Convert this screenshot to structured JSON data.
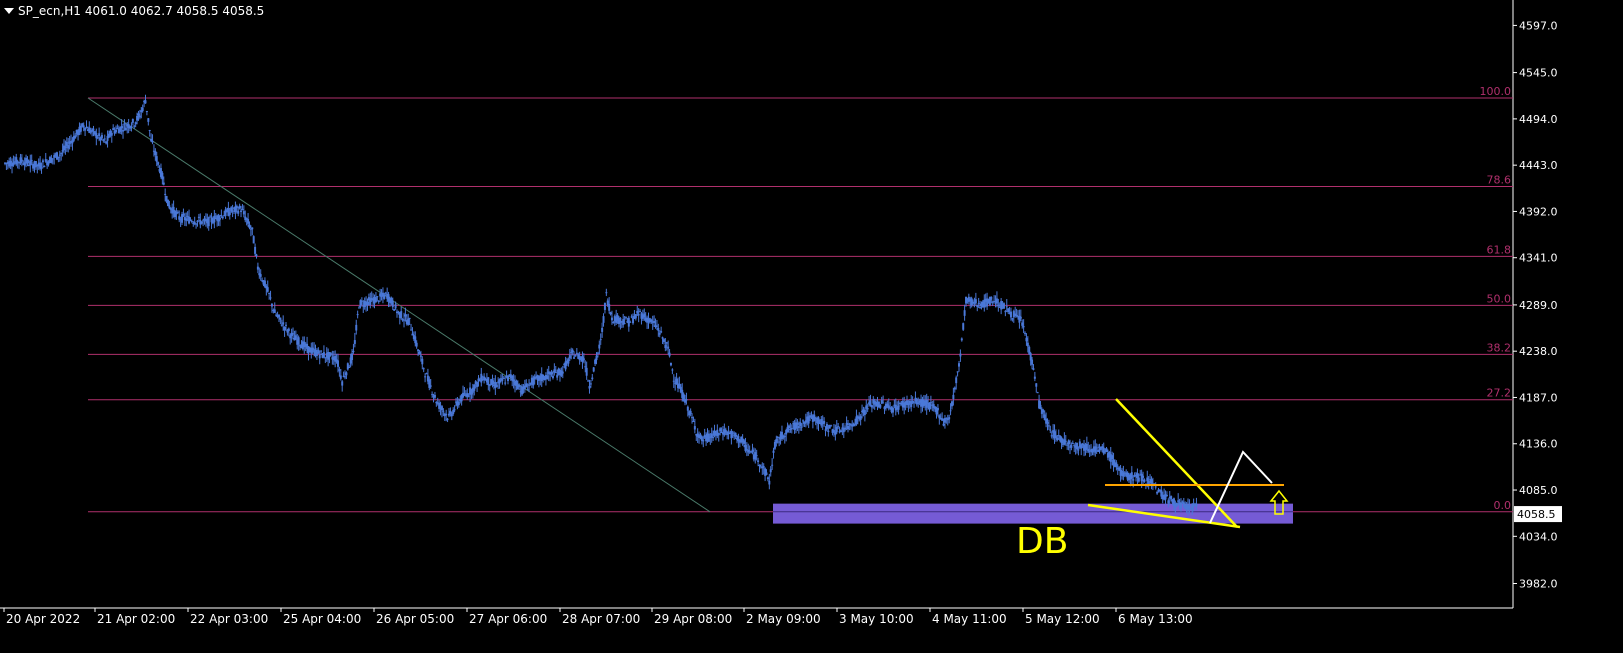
{
  "header": {
    "symbol": "SP_ecn,H1",
    "ohlc": "4061.0 4062.7 4058.5 4058.5"
  },
  "y_ticks": [
    "4597.0",
    "4545.0",
    "4494.0",
    "4443.0",
    "4392.0",
    "4341.0",
    "4289.0",
    "4238.0",
    "4187.0",
    "4136.0",
    "4085.0",
    "4034.0",
    "3982.0"
  ],
  "x_ticks": [
    "20 Apr 2022",
    "21 Apr 02:00",
    "22 Apr 03:00",
    "25 Apr 04:00",
    "26 Apr 05:00",
    "27 Apr 06:00",
    "28 Apr 07:00",
    "29 Apr 08:00",
    "2 May 09:00",
    "3 May 10:00",
    "4 May 11:00",
    "5 May 12:00",
    "6 May 13:00"
  ],
  "price_label": "4058.5",
  "fib_levels": [
    "100.0",
    "78.6",
    "61.8",
    "50.0",
    "38.2",
    "27.2",
    "0.0"
  ],
  "annotation": "DB",
  "colors": {
    "background": "#000000",
    "axis": "#ffffff",
    "candle": "#4a78d8",
    "fib": "#b0306c",
    "zone": "#7b60e0",
    "trendline": "#ffff00",
    "resistance": "#ffa500",
    "projection": "#ffffff",
    "arrow": "#ffff00",
    "diagonal": "#4a7a6a"
  },
  "chart_data": {
    "type": "candlestick",
    "ylim": [
      3955,
      4625
    ],
    "price_line": 4058.5,
    "fib_prices": [
      4517,
      4419.5,
      4342.5,
      4288.5,
      4234.5,
      4184.5,
      4061
    ],
    "path": [
      [
        0,
        4445
      ],
      [
        3,
        4448
      ],
      [
        6,
        4442
      ],
      [
        10,
        4456
      ],
      [
        14,
        4487
      ],
      [
        18,
        4468
      ],
      [
        19,
        4480
      ],
      [
        23,
        4490
      ],
      [
        24,
        4498
      ],
      [
        25,
        4515
      ],
      [
        26,
        4470
      ],
      [
        28,
        4430
      ],
      [
        29,
        4400
      ],
      [
        31,
        4385
      ],
      [
        36,
        4380
      ],
      [
        40,
        4392
      ],
      [
        42,
        4395
      ],
      [
        44,
        4370
      ],
      [
        45,
        4330
      ],
      [
        47,
        4300
      ],
      [
        48,
        4280
      ],
      [
        51,
        4255
      ],
      [
        54,
        4240
      ],
      [
        56,
        4235
      ],
      [
        59,
        4230
      ],
      [
        60,
        4205
      ],
      [
        62,
        4235
      ],
      [
        63,
        4290
      ],
      [
        66,
        4295
      ],
      [
        68,
        4300
      ],
      [
        70,
        4280
      ],
      [
        71,
        4275
      ],
      [
        72,
        4270
      ],
      [
        74,
        4230
      ],
      [
        75,
        4210
      ],
      [
        77,
        4180
      ],
      [
        79,
        4165
      ],
      [
        81,
        4185
      ],
      [
        83,
        4195
      ],
      [
        85,
        4210
      ],
      [
        87,
        4200
      ],
      [
        90,
        4210
      ],
      [
        92,
        4195
      ],
      [
        94,
        4205
      ],
      [
        97,
        4212
      ],
      [
        99,
        4215
      ],
      [
        101,
        4235
      ],
      [
        103,
        4230
      ],
      [
        104,
        4200
      ],
      [
        106,
        4248
      ],
      [
        107,
        4300
      ],
      [
        108,
        4275
      ],
      [
        111,
        4270
      ],
      [
        113,
        4280
      ],
      [
        116,
        4265
      ],
      [
        118,
        4240
      ],
      [
        119,
        4210
      ],
      [
        121,
        4185
      ],
      [
        123,
        4150
      ],
      [
        124,
        4140
      ],
      [
        126,
        4145
      ],
      [
        128,
        4150
      ],
      [
        131,
        4140
      ],
      [
        132,
        4130
      ],
      [
        134,
        4120
      ],
      [
        136,
        4095
      ],
      [
        137,
        4135
      ],
      [
        139,
        4150
      ],
      [
        142,
        4160
      ],
      [
        144,
        4165
      ],
      [
        146,
        4155
      ],
      [
        148,
        4150
      ],
      [
        150,
        4155
      ],
      [
        152,
        4165
      ],
      [
        154,
        4180
      ],
      [
        156,
        4180
      ],
      [
        158,
        4175
      ],
      [
        160,
        4180
      ],
      [
        162,
        4182
      ],
      [
        164,
        4180
      ],
      [
        166,
        4172
      ],
      [
        167,
        4160
      ],
      [
        168,
        4165
      ],
      [
        169,
        4195
      ],
      [
        170,
        4235
      ],
      [
        171,
        4295
      ],
      [
        172,
        4292
      ],
      [
        174,
        4290
      ],
      [
        176,
        4295
      ],
      [
        178,
        4285
      ],
      [
        180,
        4275
      ],
      [
        181,
        4270
      ],
      [
        183,
        4220
      ],
      [
        184,
        4180
      ],
      [
        186,
        4150
      ],
      [
        188,
        4140
      ],
      [
        190,
        4135
      ],
      [
        193,
        4132
      ],
      [
        196,
        4127
      ],
      [
        198,
        4110
      ],
      [
        199,
        4100
      ],
      [
        201,
        4100
      ],
      [
        204,
        4095
      ],
      [
        205,
        4085
      ],
      [
        207,
        4075
      ],
      [
        210,
        4066
      ],
      [
        212,
        4066
      ]
    ]
  }
}
